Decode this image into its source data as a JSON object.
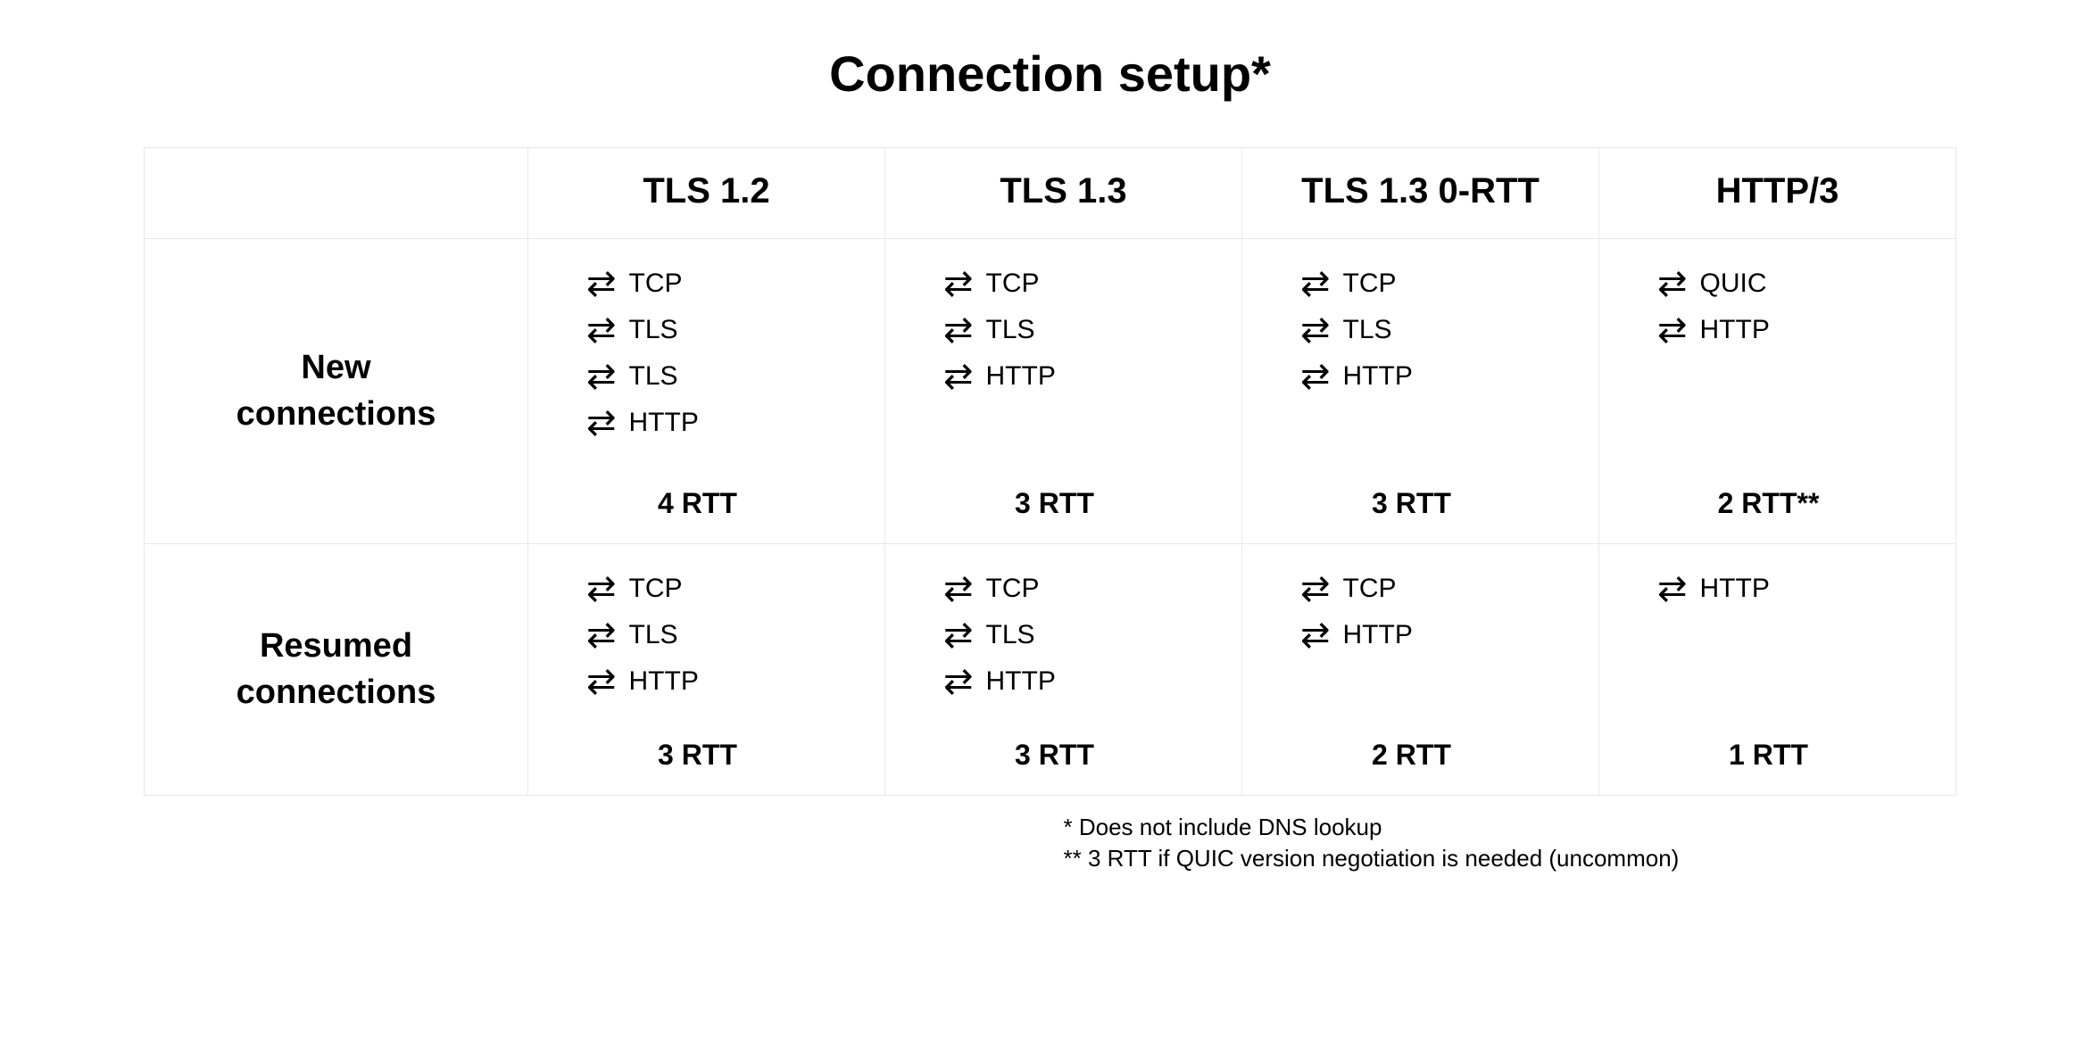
{
  "title": "Connection setup*",
  "columns": {
    "tls12": "TLS 1.2",
    "tls13": "TLS 1.3",
    "tls13_0rtt": "TLS 1.3 0-RTT",
    "http3": "HTTP/3"
  },
  "rows": {
    "new": "New connections",
    "resumed": "Resumed connections"
  },
  "chart_data": {
    "type": "table",
    "cells": {
      "new": {
        "tls12": {
          "steps": [
            "TCP",
            "TLS",
            "TLS",
            "HTTP"
          ],
          "rtt": "4 RTT"
        },
        "tls13": {
          "steps": [
            "TCP",
            "TLS",
            "HTTP"
          ],
          "rtt": "3 RTT"
        },
        "tls13_0rtt": {
          "steps": [
            "TCP",
            "TLS",
            "HTTP"
          ],
          "rtt": "3 RTT"
        },
        "http3": {
          "steps": [
            "QUIC",
            "HTTP"
          ],
          "rtt": "2 RTT**"
        }
      },
      "resumed": {
        "tls12": {
          "steps": [
            "TCP",
            "TLS",
            "HTTP"
          ],
          "rtt": "3 RTT"
        },
        "tls13": {
          "steps": [
            "TCP",
            "TLS",
            "HTTP"
          ],
          "rtt": "3 RTT"
        },
        "tls13_0rtt": {
          "steps": [
            "TCP",
            "HTTP"
          ],
          "rtt": "2 RTT"
        },
        "http3": {
          "steps": [
            "HTTP"
          ],
          "rtt": "1 RTT"
        }
      }
    }
  },
  "footnotes": {
    "f1": "* Does not include DNS lookup",
    "f2": "** 3 RTT if QUIC version negotiation is needed (uncommon)"
  },
  "icons": {
    "bidir_arrows": "⇄"
  }
}
